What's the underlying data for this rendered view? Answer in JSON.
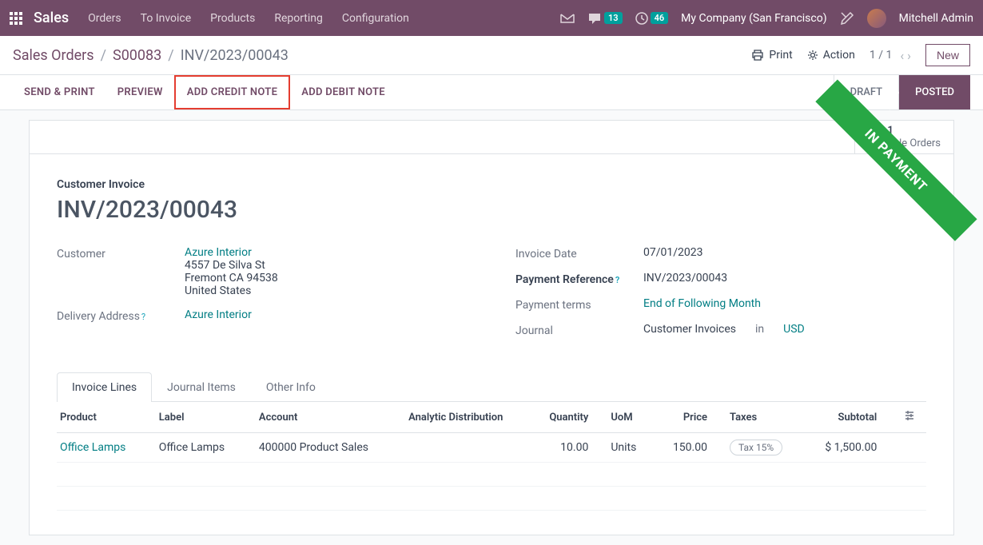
{
  "topbar": {
    "brand": "Sales",
    "nav": [
      "Orders",
      "To Invoice",
      "Products",
      "Reporting",
      "Configuration"
    ],
    "messages_badge": "13",
    "activities_badge": "46",
    "company": "My Company (San Francisco)",
    "user": "Mitchell Admin"
  },
  "breadcrumb": {
    "root": "Sales Orders",
    "order": "S00083",
    "current": "INV/2023/00043"
  },
  "control": {
    "print": "Print",
    "action": "Action",
    "page": "1 / 1",
    "new": "New"
  },
  "actions": {
    "send_print": "SEND & PRINT",
    "preview": "PREVIEW",
    "add_credit": "ADD CREDIT NOTE",
    "add_debit": "ADD DEBIT NOTE"
  },
  "status": {
    "draft": "DRAFT",
    "posted": "POSTED"
  },
  "stat": {
    "count": "1",
    "label": "Sale Orders"
  },
  "ribbon": "IN PAYMENT",
  "doc": {
    "type_label": "Customer Invoice",
    "number": "INV/2023/00043"
  },
  "left_fields": {
    "customer_label": "Customer",
    "customer_name": "Azure Interior",
    "addr1": "4557 De Silva St",
    "addr2": "Fremont CA 94538",
    "addr3": "United States",
    "delivery_label": "Delivery Address",
    "delivery_name": "Azure Interior"
  },
  "right_fields": {
    "invoice_date_label": "Invoice Date",
    "invoice_date": "07/01/2023",
    "payment_ref_label": "Payment Reference",
    "payment_ref": "INV/2023/00043",
    "payment_terms_label": "Payment terms",
    "payment_terms": "End of Following Month",
    "journal_label": "Journal",
    "journal": "Customer Invoices",
    "in": "in",
    "currency": "USD"
  },
  "tabs": [
    "Invoice Lines",
    "Journal Items",
    "Other Info"
  ],
  "table": {
    "headers": {
      "product": "Product",
      "label": "Label",
      "account": "Account",
      "analytic": "Analytic Distribution",
      "quantity": "Quantity",
      "uom": "UoM",
      "price": "Price",
      "taxes": "Taxes",
      "subtotal": "Subtotal"
    },
    "row": {
      "product": "Office Lamps",
      "label": "Office Lamps",
      "account": "400000 Product Sales",
      "analytic": "",
      "quantity": "10.00",
      "uom": "Units",
      "price": "150.00",
      "tax": "Tax 15%",
      "subtotal": "$ 1,500.00"
    }
  }
}
